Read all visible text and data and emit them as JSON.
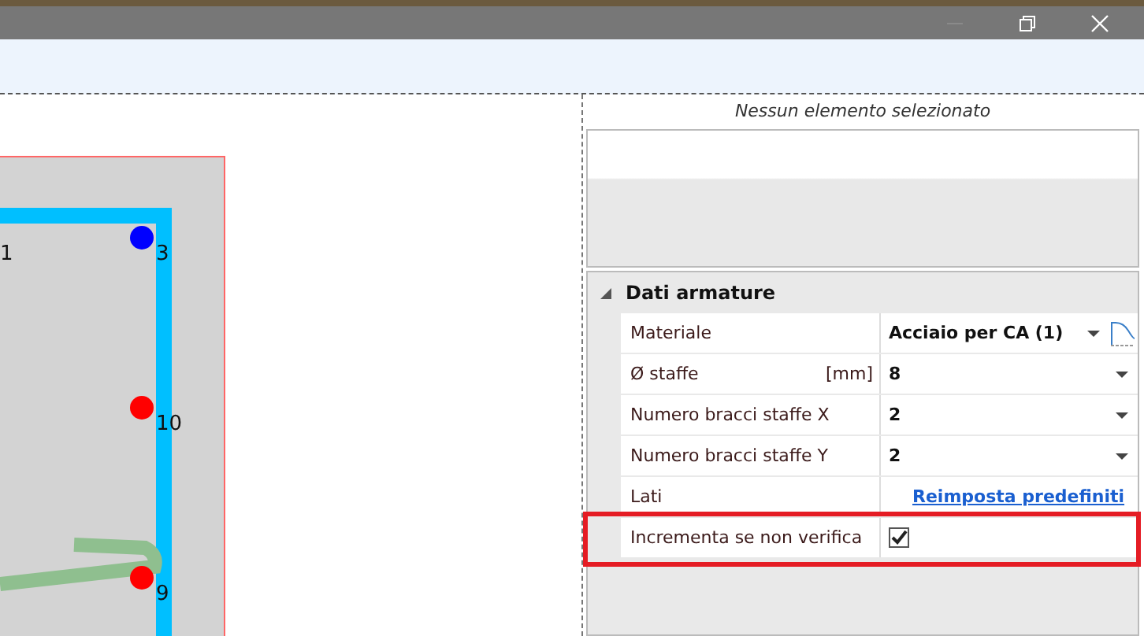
{
  "canvas": {
    "points": [
      {
        "label": "1"
      },
      {
        "label": "3",
        "color": "#0000ff"
      },
      {
        "label": "10",
        "color": "#ff0000"
      },
      {
        "label": "9",
        "color": "#ff0000"
      }
    ]
  },
  "selection_panel": {
    "caption": "Nessun elemento selezionato"
  },
  "property_grid": {
    "section": {
      "title": "Dati armature",
      "expanded": true
    },
    "rows": [
      {
        "kind": "dropdown",
        "label": "Materiale",
        "value": "Acciaio per CA (1)",
        "editor_button": true,
        "highlighted": false
      },
      {
        "kind": "dropdown",
        "label": "Ø staffe",
        "unit": "[mm]",
        "value": "8",
        "highlighted": false
      },
      {
        "kind": "dropdown",
        "label": "Numero bracci staffe X",
        "value": "2",
        "highlighted": false
      },
      {
        "kind": "dropdown",
        "label": "Numero bracci staffe Y",
        "value": "2",
        "highlighted": false
      },
      {
        "kind": "link",
        "label": "Lati",
        "value": "Reimposta predefiniti",
        "highlighted": false
      },
      {
        "kind": "checkbox",
        "label": "Incrementa se non verifica",
        "checked": true,
        "highlighted": true
      }
    ]
  }
}
